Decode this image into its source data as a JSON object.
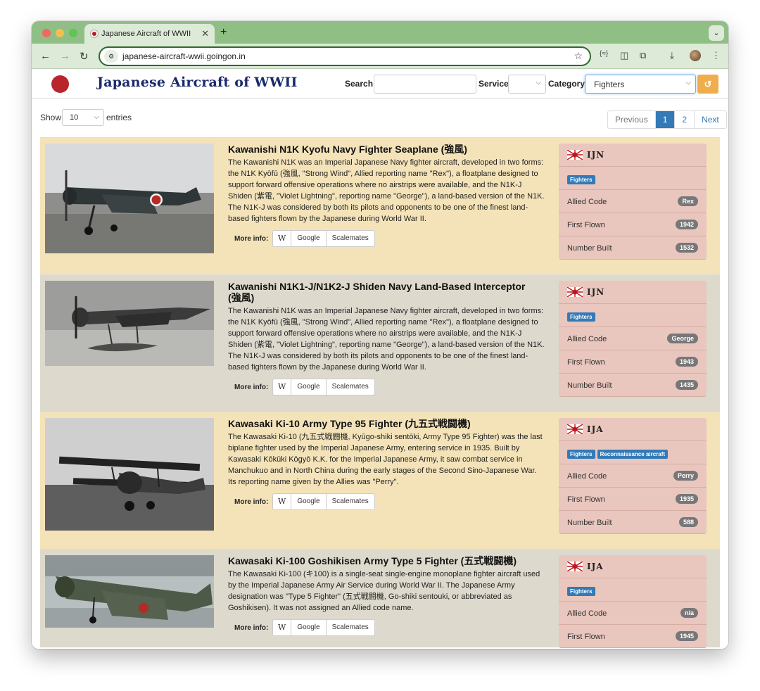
{
  "browser": {
    "tab_title": "Japanese Aircraft of WWII",
    "url": "japanese-aircraft-wwii.goingon.in"
  },
  "header": {
    "brand": "Japanese Aircraft of WWII",
    "search_label": "Search",
    "search_value": "",
    "service_label": "Service",
    "service_value": "",
    "category_label": "Category",
    "category_value": "Fighters"
  },
  "table": {
    "show_label": "Show",
    "page_length": "10",
    "entries_label": "entries",
    "pagination": [
      "Previous",
      "1",
      "2",
      "Next"
    ],
    "current_page": "1"
  },
  "labels": {
    "more_info": "More info:",
    "wiki": "W",
    "google": "Google",
    "scalemates": "Scalemates",
    "allied_code": "Allied Code",
    "first_flown": "First Flown",
    "number_built": "Number Built"
  },
  "aircraft": [
    {
      "title": "Kawanishi N1K Kyofu Navy Fighter Seaplane (強風)",
      "description": "The Kawanishi N1K was an Imperial Japanese Navy fighter aircraft, developed in two forms: the N1K Kyōfū (強風, \"Strong Wind\", Allied reporting name \"Rex\"), a floatplane designed to support forward offensive operations where no airstrips were available, and the N1K-J Shiden (紫電, \"Violet Lightning\", reporting name \"George\"), a land-based version of the N1K. The N1K-J was considered by both its pilots and opponents to be one of the finest land-based fighters flown by the Japanese during World War II.",
      "service": "IJN",
      "tags": [
        "Fighters"
      ],
      "allied_code": "Rex",
      "first_flown": "1942",
      "number_built": "1532"
    },
    {
      "title": "Kawanishi N1K1-J/N1K2-J Shiden Navy Land-Based Interceptor (強風)",
      "description": "The Kawanishi N1K was an Imperial Japanese Navy fighter aircraft, developed in two forms: the N1K Kyōfū (強風, \"Strong Wind\", Allied reporting name \"Rex\"), a floatplane designed to support forward offensive operations where no airstrips were available, and the N1K-J Shiden (紫電, \"Violet Lightning\", reporting name \"George\"), a land-based version of the N1K. The N1K-J was considered by both its pilots and opponents to be one of the finest land-based fighters flown by the Japanese during World War II.",
      "service": "IJN",
      "tags": [
        "Fighters"
      ],
      "allied_code": "George",
      "first_flown": "1943",
      "number_built": "1435"
    },
    {
      "title": "Kawasaki Ki-10 Army Type 95 Fighter (九五式戦闘機)",
      "description": "The Kawasaki Ki-10 (九五式戦闘機, Kyūgo-shiki sentōki, Army Type 95 Fighter) was the last biplane fighter used by the Imperial Japanese Army, entering service in 1935. Built by Kawasaki Kōkūki Kōgyō K.K. for the Imperial Japanese Army, it saw combat service in Manchukuo and in North China during the early stages of the Second Sino-Japanese War. Its reporting name given by the Allies was \"Perry\".",
      "service": "IJA",
      "tags": [
        "Fighters",
        "Reconnaissance aircraft"
      ],
      "allied_code": "Perry",
      "first_flown": "1935",
      "number_built": "588"
    },
    {
      "title": "Kawasaki Ki-100 Goshikisen Army Type 5 Fighter (五式戦闘機)",
      "description": "The Kawasaki Ki-100 (キ100) is a single-seat single-engine monoplane fighter aircraft used by the Imperial Japanese Army Air Service during World War II. The Japanese Army designation was \"Type 5 Fighter\" (五式戦闘機, Go-shiki sentouki, or abbreviated as Goshikisen). It was not assigned an Allied code name.",
      "service": "IJA",
      "tags": [
        "Fighters"
      ],
      "allied_code": "n/a",
      "first_flown": "1945",
      "number_built": ""
    }
  ],
  "colors": {
    "tabbar": "#8fbf84",
    "row_odd": "#f4e3b9",
    "row_even": "#ddd9cc",
    "info_panel": "#e9c6be",
    "badge": "#777777",
    "tag": "#337ab7",
    "reset_button": "#f0ad4e",
    "brand_text": "#1a2a6c"
  },
  "icons": {
    "back": "arrow-left-icon",
    "forward": "arrow-right-icon",
    "reload": "reload-icon",
    "site_info": "tune-icon",
    "bookmark": "star-icon",
    "reset": "undo-icon",
    "logo": "hinomaru-logo",
    "service_flag": "rising-sun-flag-icon"
  }
}
